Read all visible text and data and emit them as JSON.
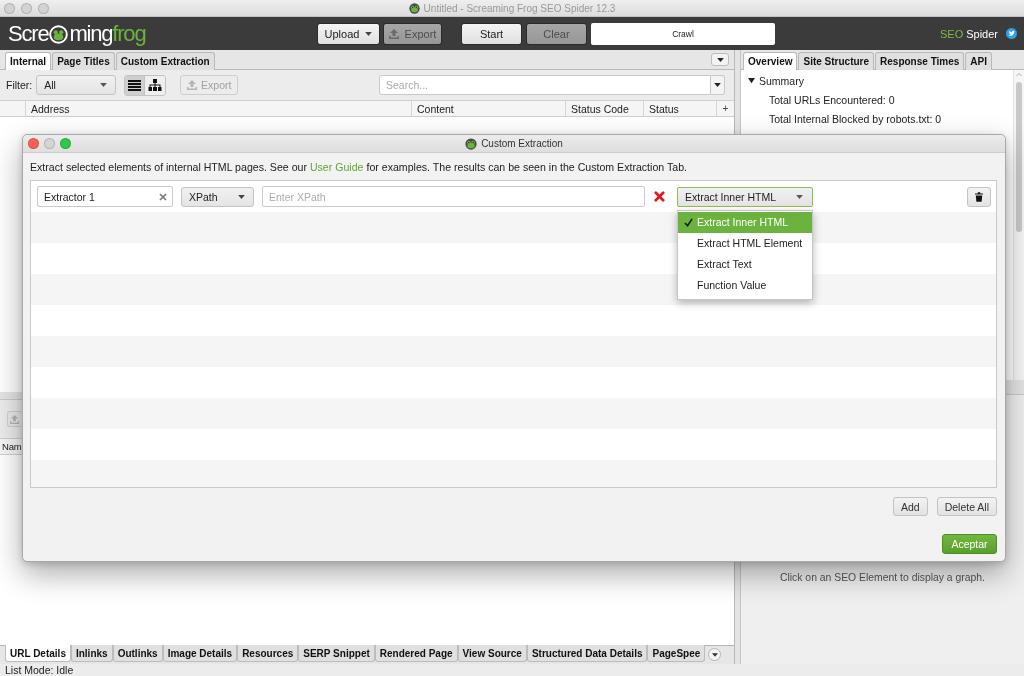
{
  "window": {
    "title": "Untitled - Screaming Frog SEO Spider 12.3"
  },
  "toolbar": {
    "logo": {
      "lead": "Scre",
      "tail": "ming",
      "accent": "frog"
    },
    "file_buttons": [
      {
        "label": "Upload",
        "kind": "menu",
        "disabled": false
      },
      {
        "label": "Export",
        "kind": "export",
        "disabled": true
      }
    ],
    "crawl_buttons": [
      {
        "label": "Start",
        "kind": "plain",
        "disabled": false
      },
      {
        "label": "Clear",
        "kind": "plain",
        "disabled": true
      }
    ],
    "status_display": {
      "label": "Crawl"
    },
    "product": {
      "accent": "SEO",
      "name": "Spider"
    }
  },
  "main_tabs": [
    {
      "label": "Internal",
      "selected": true
    },
    {
      "label": "Page Titles",
      "selected": false
    },
    {
      "label": "Custom Extraction",
      "selected": false
    }
  ],
  "filter": {
    "label": "Filter:",
    "value": "All"
  },
  "view_modes": [
    {
      "kind": "list",
      "selected": true
    },
    {
      "kind": "tree",
      "selected": false
    }
  ],
  "export_button": {
    "label": "Export",
    "disabled": true
  },
  "search": {
    "placeholder": "Search..."
  },
  "table": {
    "columns": [
      "Address",
      "Content",
      "Status Code",
      "Status"
    ],
    "add_column": "+"
  },
  "details_export": {
    "disabled": true
  },
  "details_table": {
    "columns": [
      "Nam"
    ]
  },
  "details_tabs": [
    {
      "label": "URL Details",
      "selected": true
    },
    {
      "label": "Inlinks",
      "selected": false
    },
    {
      "label": "Outlinks",
      "selected": false
    },
    {
      "label": "Image Details",
      "selected": false
    },
    {
      "label": "Resources",
      "selected": false
    },
    {
      "label": "SERP Snippet",
      "selected": false
    },
    {
      "label": "Rendered Page",
      "selected": false
    },
    {
      "label": "View Source",
      "selected": false
    },
    {
      "label": "Structured Data Details",
      "selected": false
    },
    {
      "label": "PageSpee",
      "selected": false
    }
  ],
  "status_bar": {
    "text": "List Mode: Idle"
  },
  "side_tabs": [
    {
      "label": "Overview",
      "selected": true
    },
    {
      "label": "Site Structure",
      "selected": false
    },
    {
      "label": "Response Times",
      "selected": false
    },
    {
      "label": "API",
      "selected": false
    }
  ],
  "overview": {
    "tree": [
      {
        "label": "Summary",
        "expanded": true,
        "children": [
          {
            "label": "Total URLs Encountered: 0"
          },
          {
            "label": "Total Internal Blocked by robots.txt: 0"
          }
        ]
      }
    ]
  },
  "graph_panel": {
    "message": "Click on an SEO Element to display a graph."
  },
  "dialog": {
    "title": "Custom Extraction",
    "description": {
      "before": "Extract selected elements of internal HTML pages. See our ",
      "link": "User Guide",
      "after": " for examples. The results can be seen in the Custom Extraction Tab."
    },
    "extractors": [
      {
        "name": "Extractor 1",
        "type": "XPath",
        "placeholder": "Enter XPath",
        "error": true,
        "output": "Extract Inner HTML",
        "menu_open": true
      }
    ],
    "output_options": [
      {
        "label": "Extract Inner HTML",
        "selected": true
      },
      {
        "label": "Extract HTML Element",
        "selected": false
      },
      {
        "label": "Extract Text",
        "selected": false
      },
      {
        "label": "Function Value",
        "selected": false
      }
    ],
    "buttons": [
      "Add",
      "Delete All"
    ],
    "confirm": "Aceptar"
  }
}
